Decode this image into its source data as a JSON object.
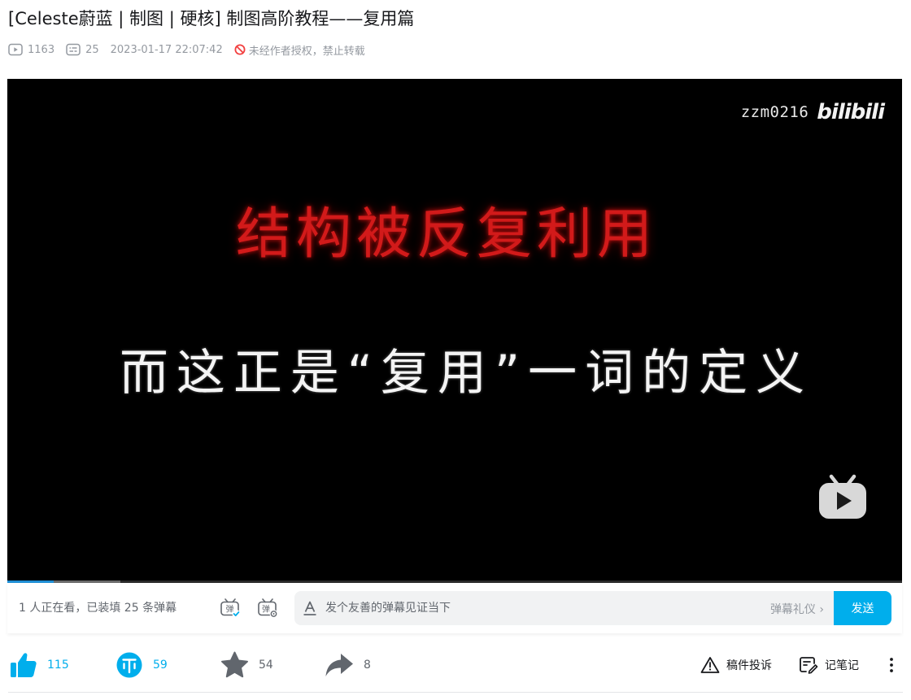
{
  "video": {
    "title": "[Celeste蔚蓝 | 制图 | 硬核] 制图高阶教程——复用篇",
    "views": "1163",
    "danmaku_count": "25",
    "published": "2023-01-17 22:07:42",
    "copyright_notice": "未经作者授权，禁止转载"
  },
  "player": {
    "watermark_user": "zzm0216",
    "watermark_logo": "bilibili",
    "subtitle_red": "结构被反复利用",
    "subtitle_white": "而这正是“复用”一词的定义",
    "progress_played_fraction": 0.052,
    "progress_loaded_fraction": 0.126
  },
  "danmaku_bar": {
    "viewers_text": "1 人正在看，已装填 25 条弹幕",
    "input_placeholder": "发个友善的弹幕见证当下",
    "etiquette_label": "弹幕礼仪 ›",
    "send_label": "发送"
  },
  "toolbar": {
    "like_count": "115",
    "coin_count": "59",
    "favorite_count": "54",
    "share_count": "8",
    "report_label": "稿件投诉",
    "notes_label": "记笔记"
  },
  "colors": {
    "accent": "#00aeec",
    "subtitle_red": "#d21a1a",
    "progress": "#1f8fd6"
  }
}
